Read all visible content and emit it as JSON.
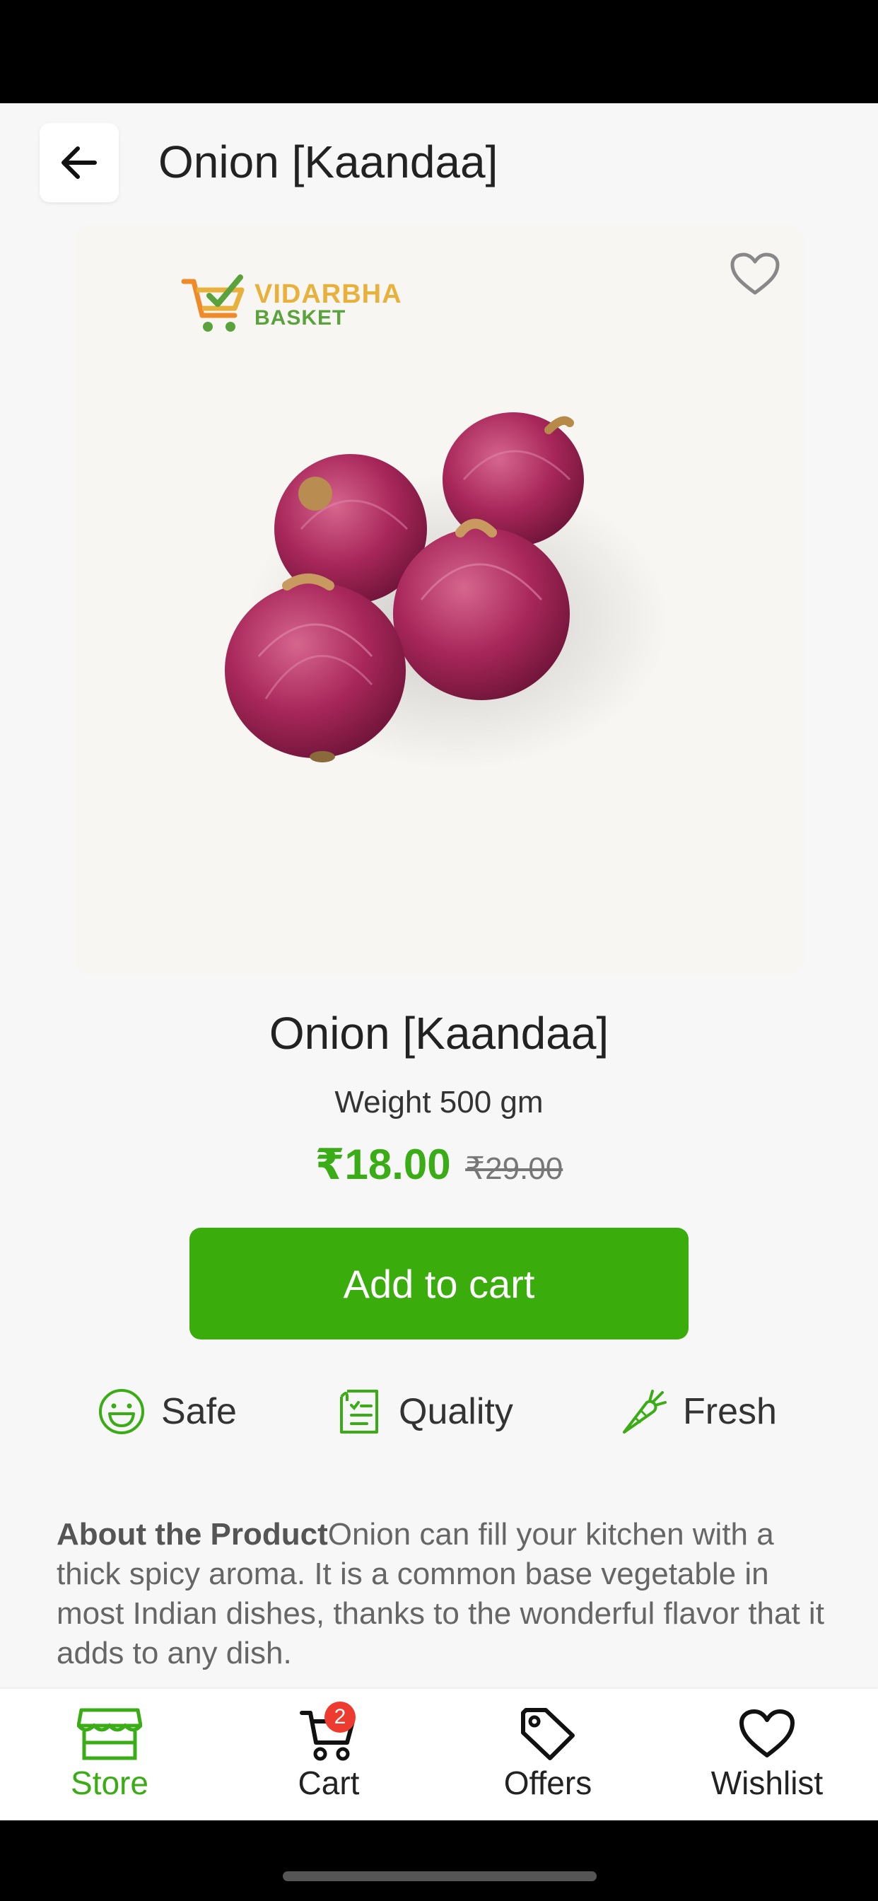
{
  "header": {
    "title": "Onion [Kaandaa]"
  },
  "product": {
    "logo_line1": "VIDARBHA",
    "logo_line2": "BASKET",
    "name": "Onion [Kaandaa]",
    "weight": "Weight 500 gm",
    "price_current": "₹18.00",
    "price_original": "₹29.00",
    "add_to_cart_label": "Add to cart"
  },
  "features": [
    {
      "label": "Safe",
      "icon": "smiley-icon"
    },
    {
      "label": "Quality",
      "icon": "checklist-icon"
    },
    {
      "label": "Fresh",
      "icon": "carrot-icon"
    }
  ],
  "about": {
    "heading": "About the Product",
    "text": "Onion can fill your kitchen with a thick spicy aroma. It is a common base vegetable in most Indian dishes, thanks to the wonderful flavor that it adds to any dish."
  },
  "bottom_nav": {
    "items": [
      {
        "label": "Store",
        "icon": "store-icon"
      },
      {
        "label": "Cart",
        "icon": "cart-icon",
        "badge": "2"
      },
      {
        "label": "Offers",
        "icon": "tag-icon"
      },
      {
        "label": "Wishlist",
        "icon": "heart-icon"
      }
    ]
  },
  "colors": {
    "accent": "#3aac15",
    "button": "#3aac0c",
    "badge": "#ee3b2f"
  }
}
